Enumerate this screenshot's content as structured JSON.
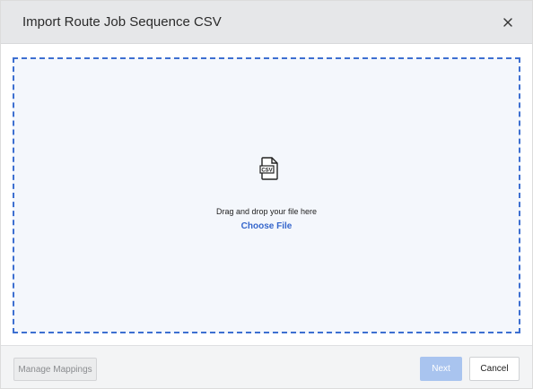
{
  "dialog": {
    "title": "Import Route Job Sequence CSV",
    "close_icon": "close-icon"
  },
  "dropzone": {
    "icon": "csv-file-icon",
    "icon_label": "CSV",
    "instruction": "Drag and drop your file here",
    "choose_file_label": "Choose File"
  },
  "footer": {
    "manage_mappings_label": "Manage Mappings",
    "next_label": "Next",
    "cancel_label": "Cancel"
  },
  "colors": {
    "header_bg": "#e6e7e9",
    "dropzone_bg": "#f4f7fc",
    "dropzone_border": "#3d6fd1",
    "link": "#3566cc",
    "next_disabled": "#a9c4ef"
  }
}
